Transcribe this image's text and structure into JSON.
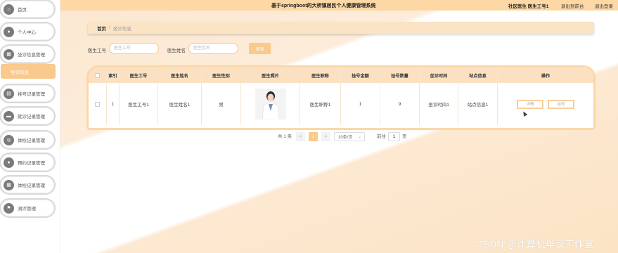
{
  "header": {
    "title": "基于springboot的大桥镇居民个人健康管理系统",
    "user": "社区医生 医生工号1",
    "link_front": "退出到前台",
    "link_logout": "退出登录"
  },
  "sidebar": {
    "items": [
      {
        "label": "首页",
        "icon": "home-icon"
      },
      {
        "label": "个人中心",
        "icon": "user-icon"
      },
      {
        "label": "坐诊信息管理",
        "icon": "grid-icon"
      },
      {
        "label": "挂号记录管理",
        "icon": "list-icon"
      },
      {
        "label": "就诊记录管理",
        "icon": "chat-icon"
      },
      {
        "label": "体检记录管理",
        "icon": "circle-icon"
      },
      {
        "label": "预约记录管理",
        "icon": "person-icon"
      },
      {
        "label": "体检记录管理",
        "icon": "grid-icon"
      },
      {
        "label": "测评管理",
        "icon": "flag-icon"
      }
    ],
    "active_sub": "坐诊信息"
  },
  "breadcrumb": {
    "home": "首页",
    "separator": "/",
    "current": "坐诊信息"
  },
  "search": {
    "doctor_no_label": "医生工号",
    "doctor_no_placeholder": "医生工号",
    "doctor_name_label": "医生姓名",
    "doctor_name_placeholder": "医生姓名",
    "button": "查询"
  },
  "table": {
    "headers": [
      "索引",
      "医生工号",
      "医生姓名",
      "医生性别",
      "医生照片",
      "医生职称",
      "挂号金额",
      "挂号数量",
      "坐诊时间",
      "站点信息",
      "操作"
    ],
    "rows": [
      {
        "index": "1",
        "doctor_no": "医生工号1",
        "doctor_name": "医生姓名1",
        "gender": "男",
        "title": "医生职称1",
        "fee": "1",
        "count": "9",
        "time": "坐诊时间1",
        "site": "站点信息1",
        "actions": [
          "详情",
          "挂号"
        ]
      }
    ]
  },
  "pagination": {
    "total": "共 1 条",
    "current_page": "1",
    "prev": "<",
    "next": ">",
    "page_size": "10条/页",
    "jump_label": "前往",
    "jump_value": "1",
    "page_unit": "页"
  },
  "watermark": "CSDN @计算机毕设工作室",
  "colors": {
    "accent": "#f9c98d",
    "header_bg": "#fdd8a5",
    "table_head": "#fbe1c2"
  }
}
